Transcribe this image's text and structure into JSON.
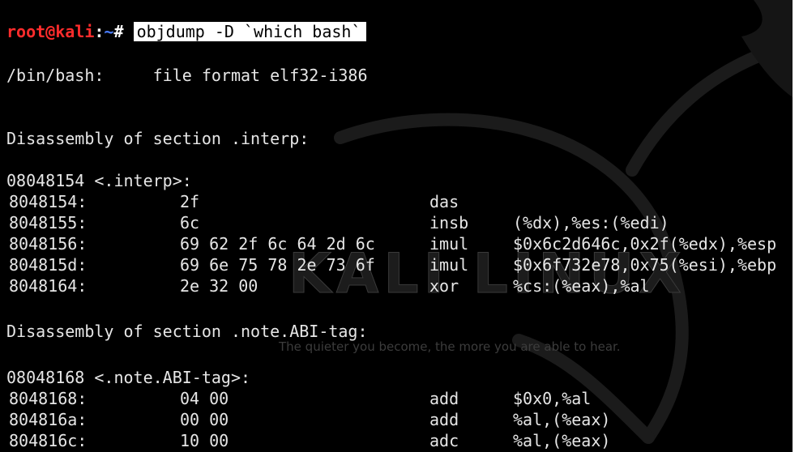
{
  "terminal": {
    "prompt": {
      "user": "root@kali",
      "separator": ":",
      "path": "~",
      "symbol": "# ",
      "command": "objdump -D `which bash`"
    },
    "file_format_line": "/bin/bash:     file format elf32-i386",
    "sections": [
      {
        "header": "Disassembly of section .interp:",
        "label": "08048154 <.interp>:",
        "rows": [
          {
            "addr": "8048154:",
            "bytes": "2f",
            "mnemonic": "das",
            "operands": ""
          },
          {
            "addr": "8048155:",
            "bytes": "6c",
            "mnemonic": "insb",
            "operands": "(%dx),%es:(%edi)"
          },
          {
            "addr": "8048156:",
            "bytes": "69 62 2f 6c 64 2d 6c",
            "mnemonic": "imul",
            "operands": "$0x6c2d646c,0x2f(%edx),%esp"
          },
          {
            "addr": "804815d:",
            "bytes": "69 6e 75 78 2e 73 6f",
            "mnemonic": "imul",
            "operands": "$0x6f732e78,0x75(%esi),%ebp"
          },
          {
            "addr": "8048164:",
            "bytes": "2e 32 00",
            "mnemonic": "xor",
            "operands": "%cs:(%eax),%al"
          }
        ]
      },
      {
        "header": "Disassembly of section .note.ABI-tag:",
        "label": "08048168 <.note.ABI-tag>:",
        "rows": [
          {
            "addr": "8048168:",
            "bytes": "04 00",
            "mnemonic": "add",
            "operands": "$0x0,%al"
          },
          {
            "addr": "804816a:",
            "bytes": "00 00",
            "mnemonic": "add",
            "operands": "%al,(%eax)"
          },
          {
            "addr": "804816c:",
            "bytes": "10 00",
            "mnemonic": "adc",
            "operands": "%al,(%eax)"
          }
        ]
      }
    ]
  },
  "wallpaper": {
    "logo_text": "KALI LINUX",
    "tagline": "The quieter you become, the more you are able to hear."
  },
  "colors": {
    "background": "#000000",
    "text": "#e6e6e6",
    "prompt_user": "#ff2c2c",
    "prompt_path": "#4a7dff"
  }
}
